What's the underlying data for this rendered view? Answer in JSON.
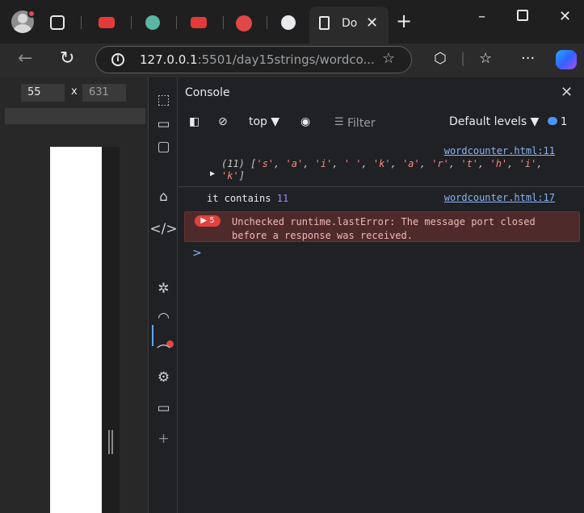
{
  "browser": {
    "active_tab_title": "Do",
    "url_host": "127.0.0.1",
    "url_path": ":5501/day15strings/wordco...",
    "tab_icon_colors": [
      "#e8eaed",
      "#e43a3a",
      "#5bb5a0",
      "#e43a3a",
      "#e04848",
      "#e8eaed"
    ]
  },
  "device_toolbar": {
    "width": "55",
    "height": "631",
    "times": "x"
  },
  "devtools": {
    "panel_title": "Console",
    "toolbar": {
      "context": "top",
      "filter_placeholder": "Filter",
      "levels": "Default levels",
      "issues_count": "1"
    },
    "messages": {
      "array_log": {
        "prefix": "(11)",
        "items": [
          "'s'",
          "'a'",
          "'i'",
          "' '",
          "'k'",
          "'a'",
          "'r'",
          "'t'",
          "'h'",
          "'i'",
          "'k'"
        ],
        "source": "wordcounter.html:11"
      },
      "contains_log": {
        "text": "it contains",
        "count": "11",
        "source": "wordcounter.html:17"
      },
      "error": {
        "badge": "5",
        "text": "Unchecked runtime.lastError: The message port closed before a response was received."
      }
    },
    "prompt_symbol": ">"
  },
  "icons": {
    "profile": "profile-avatar-icon",
    "tabs": "tab-actions-icon",
    "back": "back-arrow-icon",
    "refresh": "refresh-icon",
    "info": "site-info-icon",
    "favorite": "star-icon",
    "extensions": "extensions-icon",
    "favorites": "favorites-icon",
    "more": "more-icon",
    "copilot": "copilot-icon"
  }
}
